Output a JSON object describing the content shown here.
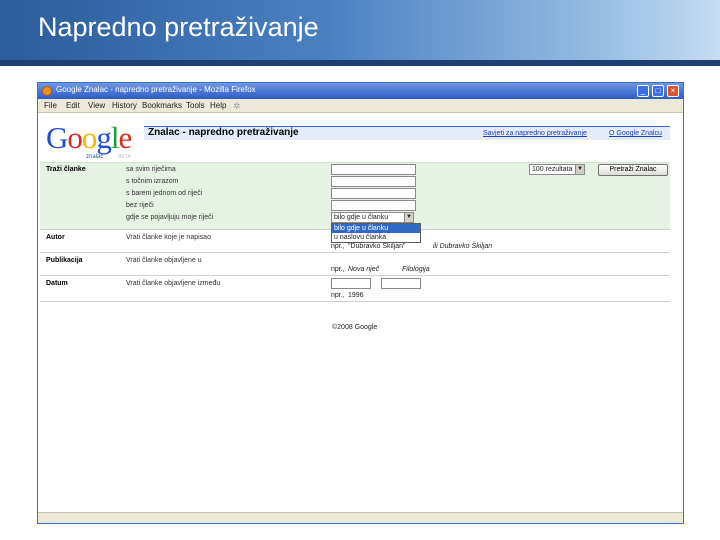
{
  "slide": {
    "title": "Napredno pretraživanje"
  },
  "window": {
    "title": "Google Znalac - napredno pretraživanje - Mozilla Firefox",
    "controls": [
      "_",
      "□",
      "×"
    ]
  },
  "menu": [
    "File",
    "Edit",
    "View",
    "History",
    "Bookmarks",
    "Tools",
    "Help"
  ],
  "logo": {
    "text": "Google",
    "sub": "znalac",
    "beta": "BETA"
  },
  "header": {
    "title": "Znalac - napredno pretraživanje",
    "links": [
      "Savjeti za napredno pretraživanje",
      "O Google Znalcu"
    ]
  },
  "find": {
    "label": "Traži članke",
    "rows": [
      "sa svim riječima",
      "s točnim izrazom",
      "s barem jednom od riječi",
      "bez riječi",
      "gdje se pojavljuju moje riječi"
    ],
    "where_selected": "bilo gdje u članku",
    "where_options": [
      "bilo gdje u članku",
      "u naslovu članka"
    ],
    "results_selected": "100 rezultata",
    "search_button": "Pretraži Znalac"
  },
  "author": {
    "label": "Autor",
    "desc": "Vrati članke koje je napisao",
    "example_prefix": "npr.,",
    "example_value": "\"Dubravko Škiljan\"",
    "example_alt": "ili Dubravko Škiljan"
  },
  "publication": {
    "label": "Publikacija",
    "desc": "Vrati članke objavljene u",
    "example_prefix": "npr.,",
    "example_values": [
      "Nova riječ",
      "Filologija"
    ]
  },
  "date": {
    "label": "Datum",
    "desc": "Vrati članke objavljene između",
    "example_prefix": "npr.,",
    "example_value": "1996"
  },
  "footer": {
    "copyright": "©2008 Google"
  },
  "colors": {
    "header_gradient_start": "#2b5c9b",
    "form_band": "#e6f2e3",
    "window_border": "#3b6fc4",
    "link": "#1a3fb8"
  }
}
